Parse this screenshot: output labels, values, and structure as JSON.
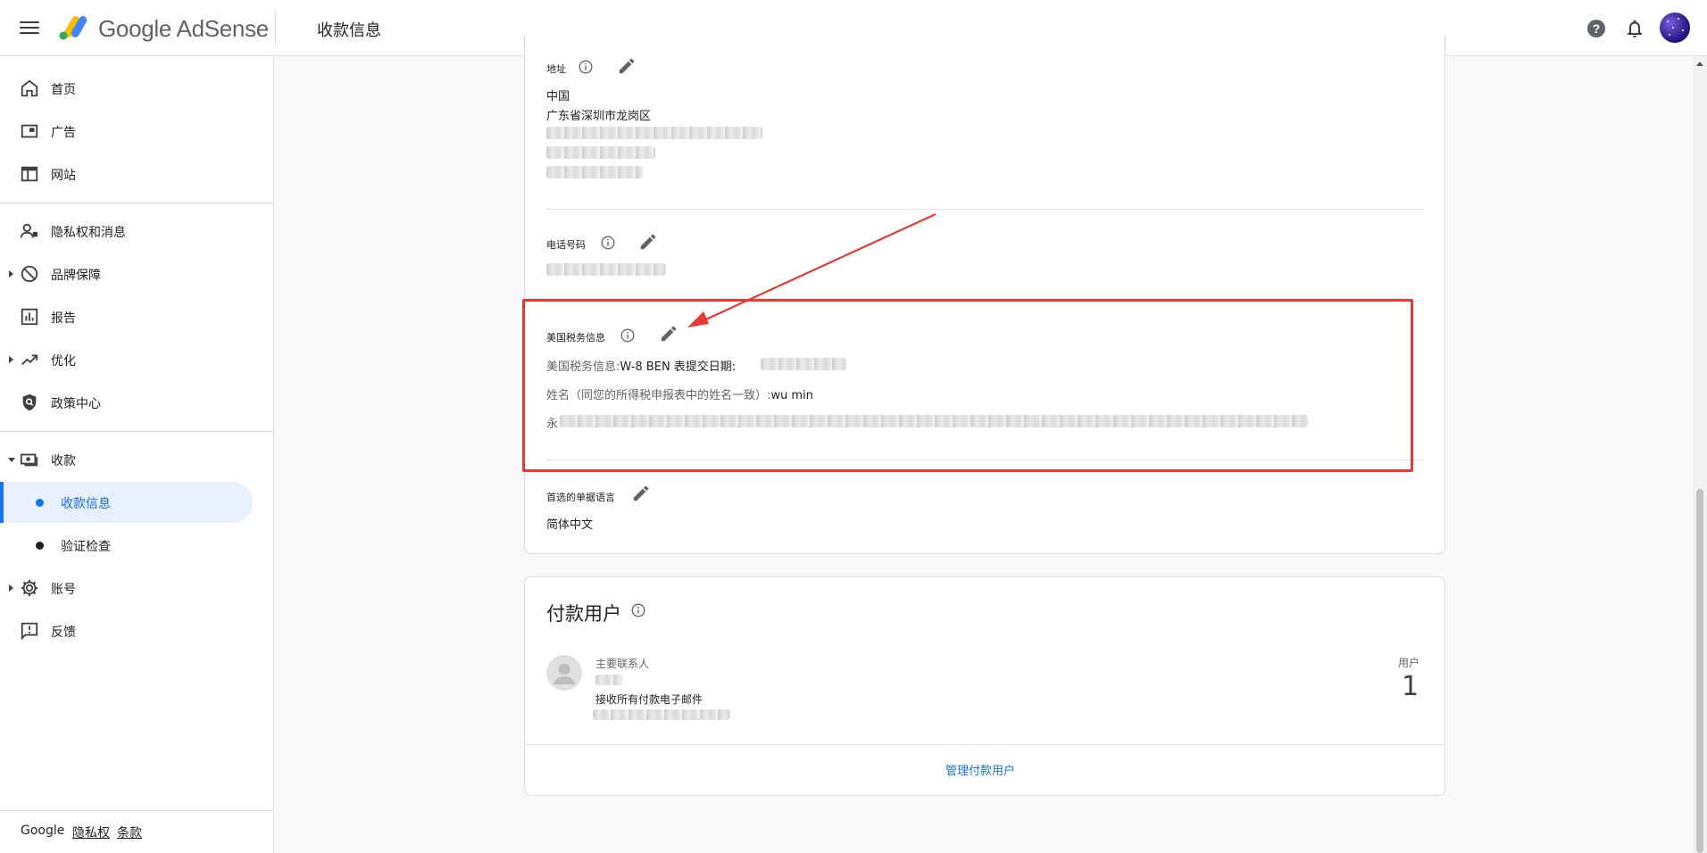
{
  "header": {
    "brand": "Google AdSense",
    "page_title": "收款信息"
  },
  "sidebar": {
    "items": [
      {
        "label": "首页"
      },
      {
        "label": "广告"
      },
      {
        "label": "网站"
      },
      {
        "label": "隐私权和消息"
      },
      {
        "label": "品牌保障"
      },
      {
        "label": "报告"
      },
      {
        "label": "优化"
      },
      {
        "label": "政策中心"
      },
      {
        "label": "收款"
      },
      {
        "label": "收款信息"
      },
      {
        "label": "验证检查"
      },
      {
        "label": "账号"
      },
      {
        "label": "反馈"
      }
    ],
    "footer": {
      "google": "Google",
      "privacy": "隐私权",
      "terms": "条款"
    }
  },
  "payment_profile": {
    "address": {
      "label": "地址",
      "country": "中国",
      "region": "广东省深圳市龙岗区"
    },
    "phone": {
      "label": "电话号码"
    },
    "us_tax": {
      "label": "美国税务信息",
      "line1_label": "美国税务信息:",
      "line1_value": "W-8 BEN 表提交日期:",
      "line2_label": "姓名（同您的所得税申报表中的姓名一致）:",
      "line2_value": "wu min",
      "line3_visible_start": "永"
    },
    "invoice_language": {
      "label": "首选的单据语言",
      "value": "简体中文"
    }
  },
  "payment_users": {
    "title": "付款用户",
    "primary_contact_label": "主要联系人",
    "receives_all_label": "接收所有付款电子邮件",
    "users_label": "用户",
    "users_count": "1",
    "manage_link": "管理付款用户"
  },
  "colors": {
    "accent": "#1a73e8",
    "annotation_red": "#e53935",
    "sidebar_active_bg": "#e8f0fe"
  }
}
